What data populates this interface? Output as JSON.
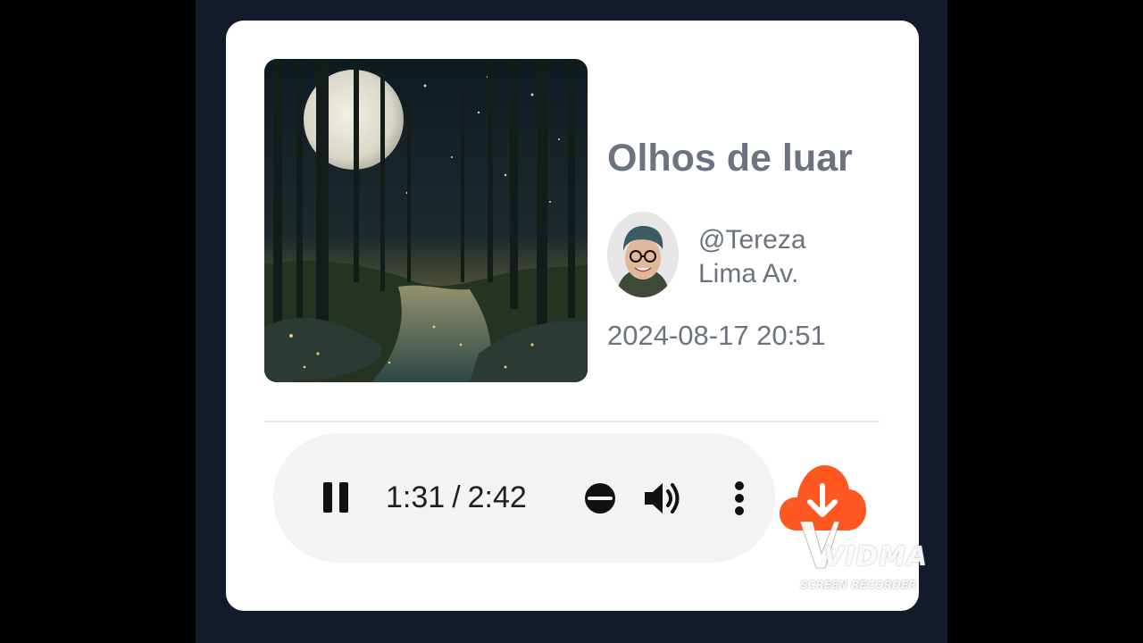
{
  "track": {
    "title": "Olhos de luar",
    "author_line1": "@Tereza",
    "author_line2": "Lima Av.",
    "date": "2024-08-17 20:51"
  },
  "player": {
    "current_time": "1:31",
    "separator": "/",
    "duration": "2:42",
    "state": "playing",
    "progress_fraction": 0.562,
    "pause_icon": "pause-icon",
    "volume_icon": "volume-icon",
    "more_icon": "more-vertical-icon"
  },
  "download": {
    "icon": "cloud-download-icon",
    "color": "#ff5722"
  },
  "watermark": {
    "brand": "VIDMA",
    "subtitle": "SCREEN RECORDER"
  },
  "colors": {
    "page_background": "#000000",
    "panel_background": "#121a2b",
    "card_background": "#ffffff",
    "text_muted": "#6b7280",
    "player_background": "#f1f3f4"
  }
}
